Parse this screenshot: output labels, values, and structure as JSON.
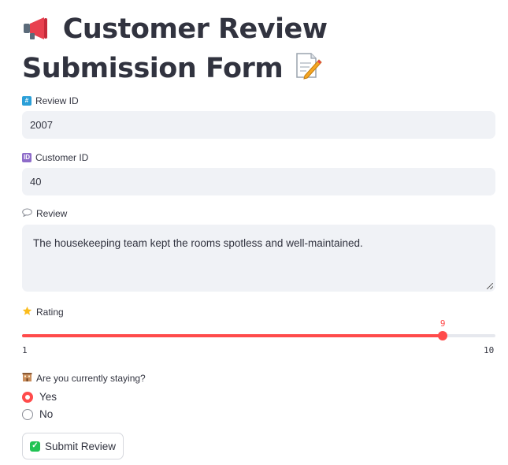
{
  "title": {
    "text": "Customer Review Submission Form",
    "lead_icon": "megaphone-icon",
    "trail_icon": "memo-icon"
  },
  "review_id": {
    "label": "Review ID",
    "icon": "numbers-icon",
    "value": "2007"
  },
  "customer_id": {
    "label": "Customer ID",
    "icon": "id-icon",
    "value": "40"
  },
  "review": {
    "label": "Review",
    "icon": "speech-bubble-icon",
    "value": "The housekeeping team kept the rooms spotless and well-maintained."
  },
  "rating": {
    "label": "Rating",
    "icon": "star-icon",
    "min": 1,
    "max": 10,
    "value": 9,
    "min_label": "1",
    "max_label": "10",
    "value_label": "9"
  },
  "staying": {
    "label": "Are you currently staying?",
    "icon": "hotel-icon",
    "options": [
      "Yes",
      "No"
    ],
    "selected": "Yes"
  },
  "submit": {
    "label": "Submit Review",
    "icon": "checkmark-icon"
  },
  "colors": {
    "accent": "#ff4b4b",
    "input_bg": "#f0f2f6",
    "text": "#31333f",
    "check_green": "#21c354"
  }
}
